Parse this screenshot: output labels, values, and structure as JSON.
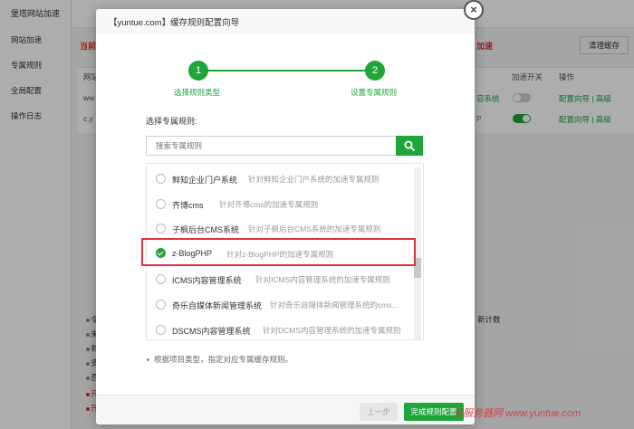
{
  "background": {
    "sidebar_title": "堡塔网站加速",
    "sidebar_items": [
      "网站加速",
      "专属规则",
      "全局配置",
      "操作日志"
    ],
    "notice_left": "当前",
    "notice_right": "加速",
    "clear_cache_button": "清理缓存",
    "table_headers": [
      "网站",
      "加速开关",
      "操作"
    ],
    "rows": [
      {
        "site": "ww",
        "rule_tail": "容系统",
        "actions": "配置向导 | 高级",
        "accelerate_on": false
      },
      {
        "site": "c.y",
        "rule_tail": "P",
        "actions": "配置向导 | 高级",
        "accelerate_on": true
      }
    ],
    "notes": [
      "令",
      "未",
      "有",
      "多",
      "否",
      "开",
      "开"
    ],
    "notes_right_tail": "新计数"
  },
  "dialog": {
    "title": "【yuntue.com】缓存规则配置向导",
    "close_icon": "close-icon",
    "steps": [
      {
        "number": "1",
        "label": "选择规则类型"
      },
      {
        "number": "2",
        "label": "设置专属规则"
      }
    ],
    "section_label": "选择专属规则:",
    "search": {
      "placeholder": "搜索专属规则",
      "icon": "search-icon"
    },
    "rules": [
      {
        "name": "鲜知企业门户系统",
        "desc": "针对鲜知企业门户系统的加速专属规则",
        "selected": false
      },
      {
        "name": "齐博cms",
        "desc": "针对齐博cms的加速专属规则",
        "selected": false
      },
      {
        "name": "子枫后台CMS系统",
        "desc": "针对子枫后台CMS系统的加速专属规则",
        "selected": false
      },
      {
        "name": "z-BlogPHP",
        "desc": "针对z-BlogPHP的加速专属规则",
        "selected": true
      },
      {
        "name": "ICMS内容管理系统",
        "desc": "针对ICMS内容管理系统的加速专属规则",
        "selected": false
      },
      {
        "name": "奇乐自媒体新闻管理系统",
        "desc": "针对奇乐自媒体新闻管理系统的cms...",
        "selected": false
      },
      {
        "name": "DSCMS内容管理系统",
        "desc": "针对DCMS内容管理系统的加速专属规则",
        "selected": false
      }
    ],
    "hint": "根据项目类型，指定对应专属缓存规则。",
    "prev_button": "上一步",
    "finish_button": "完成规则配置"
  },
  "watermark": "云服务器网 www.yuntue.com",
  "colors": {
    "accent": "#20a53a",
    "highlight": "#d9333f"
  }
}
